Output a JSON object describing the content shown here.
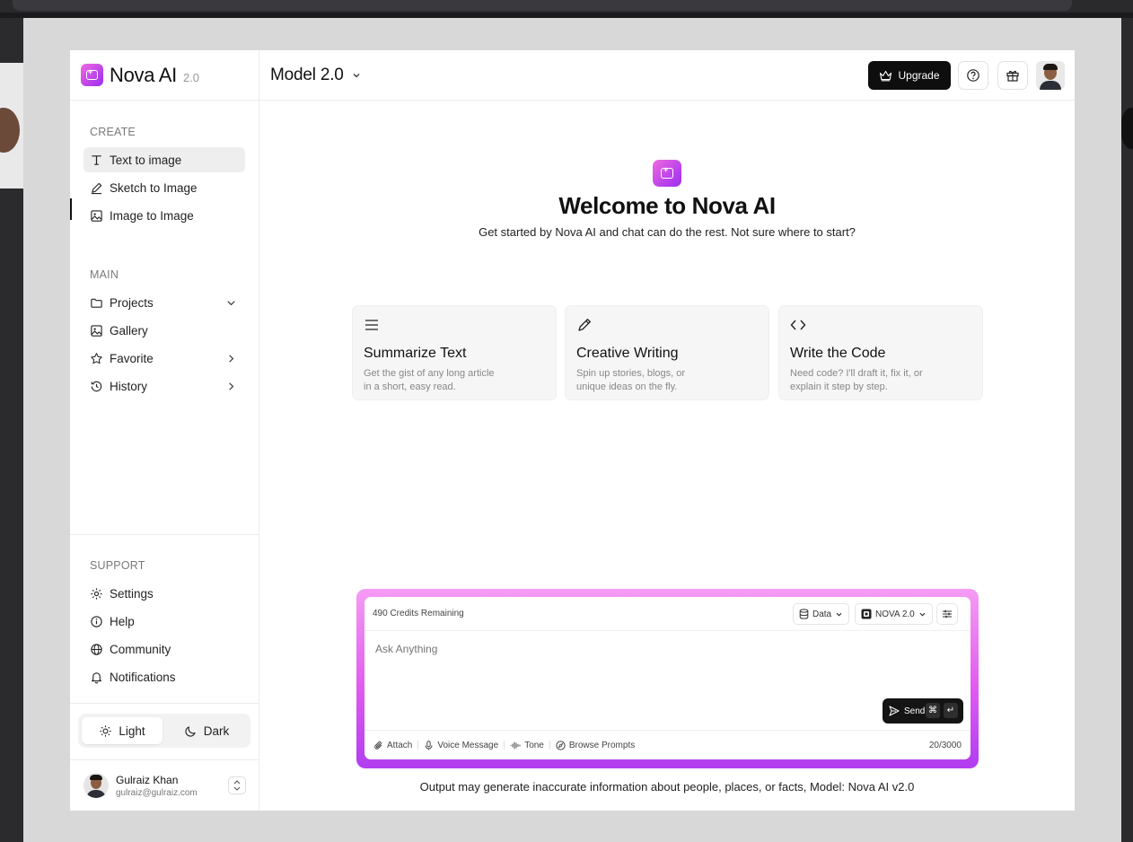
{
  "brand": {
    "name": "Nova AI",
    "version": "2.0"
  },
  "header": {
    "model": "Model 2.0",
    "upgrade_label": "Upgrade"
  },
  "sidebar": {
    "create_label": "CREATE",
    "create_items": [
      {
        "label": "Text to image",
        "icon": "type-icon",
        "active": true
      },
      {
        "label": "Sketch to Image",
        "icon": "pen-icon"
      },
      {
        "label": "Image to Image",
        "icon": "image-icon"
      }
    ],
    "main_label": "MAIN",
    "main_items": [
      {
        "label": "Projects",
        "icon": "folder-icon",
        "chevron": "down"
      },
      {
        "label": "Gallery",
        "icon": "image-icon"
      },
      {
        "label": "Favorite",
        "icon": "star-icon",
        "chevron": "right"
      },
      {
        "label": "History",
        "icon": "history-icon",
        "chevron": "right"
      }
    ],
    "support_label": "SUPPORT",
    "support_items": [
      {
        "label": "Settings",
        "icon": "gear-icon"
      },
      {
        "label": "Help",
        "icon": "info-icon"
      },
      {
        "label": "Community",
        "icon": "globe-icon"
      },
      {
        "label": "Notifications",
        "icon": "bell-icon"
      }
    ],
    "theme": {
      "light": "Light",
      "dark": "Dark",
      "selected": "Light"
    },
    "user": {
      "name": "Gulraiz Khan",
      "email": "gulraiz@gulraiz.com"
    }
  },
  "hero": {
    "title": "Welcome to Nova AI",
    "subtitle": "Get started by Nova AI and chat can do the rest. Not sure where to start?"
  },
  "cards": [
    {
      "title": "Summarize Text",
      "desc": "Get the gist of any long article in a short, easy read.",
      "icon": "menu-lines-icon"
    },
    {
      "title": "Creative Writing",
      "desc": "Spin up stories, blogs, or unique ideas on the fly.",
      "icon": "pen-icon"
    },
    {
      "title": "Write the Code",
      "desc": "Need code? I'll draft it, fix it, or explain it step by step.",
      "icon": "code-icon"
    }
  ],
  "composer": {
    "credits": "490 Credits Remaining",
    "data_label": "Data",
    "model_label": "NOVA 2.0",
    "placeholder": "Ask Anything",
    "send_label": "Send",
    "attach": "Attach",
    "voice": "Voice Message",
    "tone": "Tone",
    "browse": "Browse Prompts",
    "counter": "20/3000"
  },
  "disclaimer": "Output may generate inaccurate information about people, places, or facts, Model: Nova AI v2.0",
  "colors": {
    "accent_gradient_start": "#f59cf4",
    "accent_gradient_end": "#b13df0",
    "button_dark": "#0e0e0e"
  }
}
